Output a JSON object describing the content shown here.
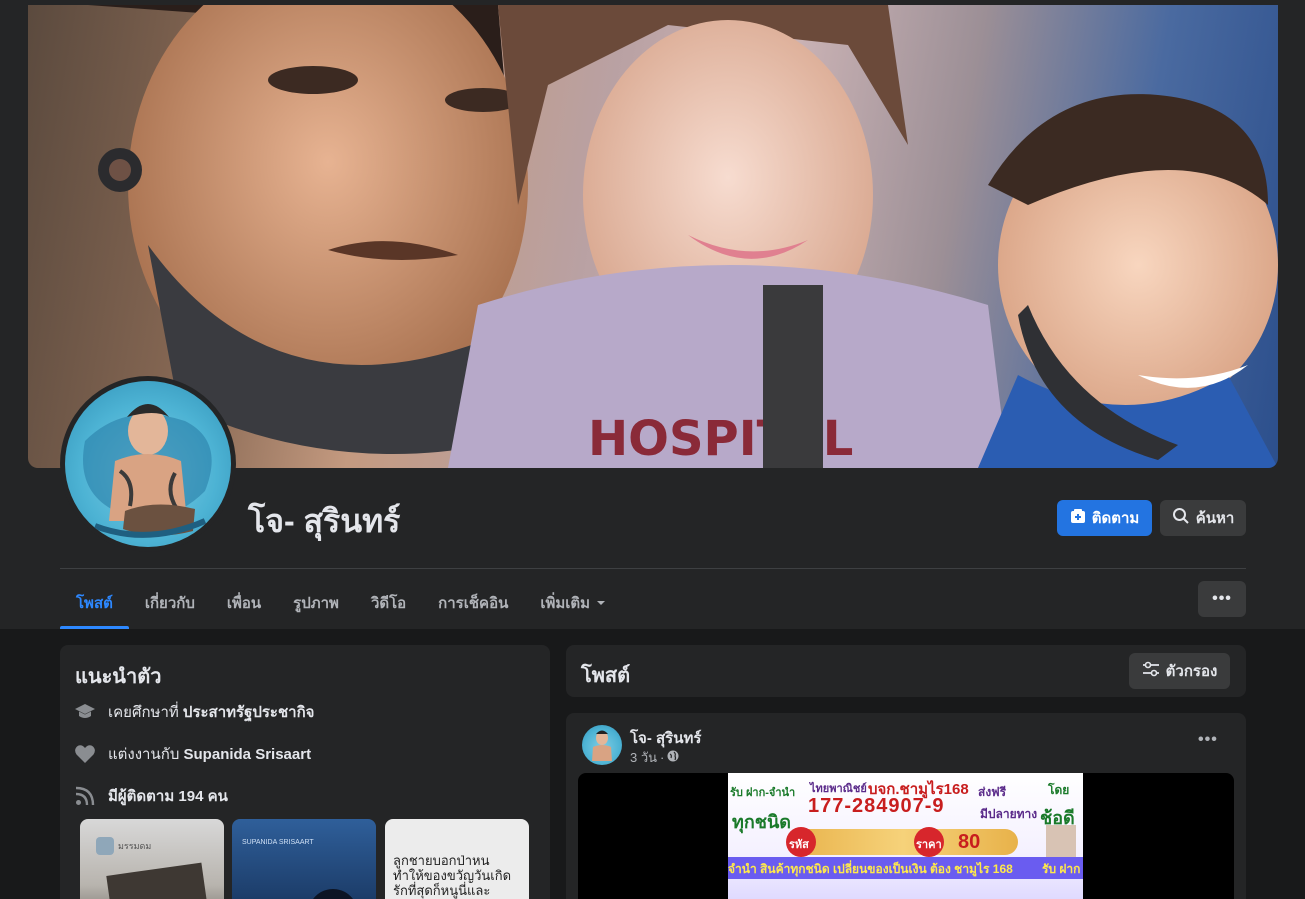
{
  "profile": {
    "name": "โจ- สุรินทร์",
    "follow_label": "ติดตาม",
    "search_label": "ค้นหา"
  },
  "tabs": [
    {
      "label": "โพสต์"
    },
    {
      "label": "เกี่ยวกับ"
    },
    {
      "label": "เพื่อน"
    },
    {
      "label": "รูปภาพ"
    },
    {
      "label": "วิดีโอ"
    },
    {
      "label": "การเช็คอิน"
    },
    {
      "label": "เพิ่มเติม"
    }
  ],
  "intro": {
    "title": "แนะนำตัว",
    "education_prefix": "เคยศึกษาที่ ",
    "education_school": "ประสาทรัฐประชากิจ",
    "relationship_prefix": "แต่งงานกับ ",
    "relationship_partner": "Supanida Srisaart",
    "followers_text": "มีผู้ติดตาม 194 คน",
    "featured": [
      {
        "caption": "มรรมดม"
      },
      {
        "caption": "SUPANIDA SRISAART"
      },
      {
        "caption": "ลูกชายบอกป่าหน ทำให้ของขวัญวันเกิด รักที่สุดก็หนูนี่และ"
      }
    ]
  },
  "posts_section": {
    "title": "โพสต์",
    "filter_label": "ตัวกรอง"
  },
  "post": {
    "author": "โจ- สุรินทร์",
    "time": "3 วัน",
    "ad": {
      "line1_left": "รับ ฝาก-จำนำ",
      "bank": "ไทยพาณิชย์",
      "company": "บจก.ชามูไร168",
      "free_ship": "ส่งฟรี",
      "by": "โดย",
      "all_types": "ทุกชนิด",
      "account": "177-284907-9",
      "destination": "มีปลายทาง",
      "brand": "ช้อดี",
      "code_label": "รหัส",
      "price_label": "ราคา",
      "price": "80",
      "ticker": "จำนำ สินค้าทุกชนิด เปลี่ยนของเป็นเงิน ต้อง ชามูไร 168",
      "ticker_right": "รับ ฝาก"
    }
  },
  "colors": {
    "background": "#18191a",
    "surface": "#242526",
    "accent": "#2374e1",
    "active_tab": "#2d88ff"
  }
}
